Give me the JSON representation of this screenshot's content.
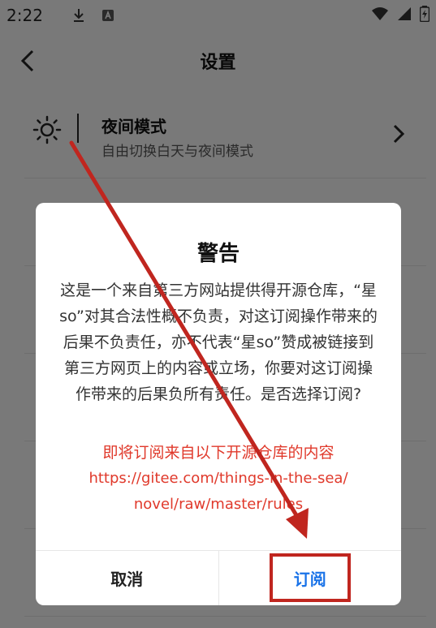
{
  "status": {
    "time": "2:22"
  },
  "header": {
    "title": "设置"
  },
  "list": {
    "items": [
      {
        "title": "夜间模式",
        "subtitle": "自由切换白天与夜间模式"
      },
      {
        "title": "",
        "subtitle": ""
      },
      {
        "title": "",
        "subtitle": ""
      },
      {
        "title": "",
        "subtitle": ""
      },
      {
        "title": "",
        "subtitle": ""
      },
      {
        "title": "",
        "subtitle": ""
      }
    ]
  },
  "dialog": {
    "title": "警告",
    "body": "这是一个来自第三方网站提供得开源仓库，“星so”对其合法性概不负责，对这订阅操作带来的后果不负责任，亦不代表“星so”赞成被链接到第三方网页上的内容或立场，你要对这订阅操作带来的后果负所有责任。是否选择订阅?",
    "note": "即将订阅来自以下开源仓库的内容",
    "url_line1": "https://gitee.com/things-in-the-sea/",
    "url_line2": "novel/raw/master/rules",
    "cancel_label": "取消",
    "confirm_label": "订阅"
  },
  "colors": {
    "accent": "#1a73e8",
    "warning": "#e0392b",
    "annotation": "#c0261f"
  }
}
